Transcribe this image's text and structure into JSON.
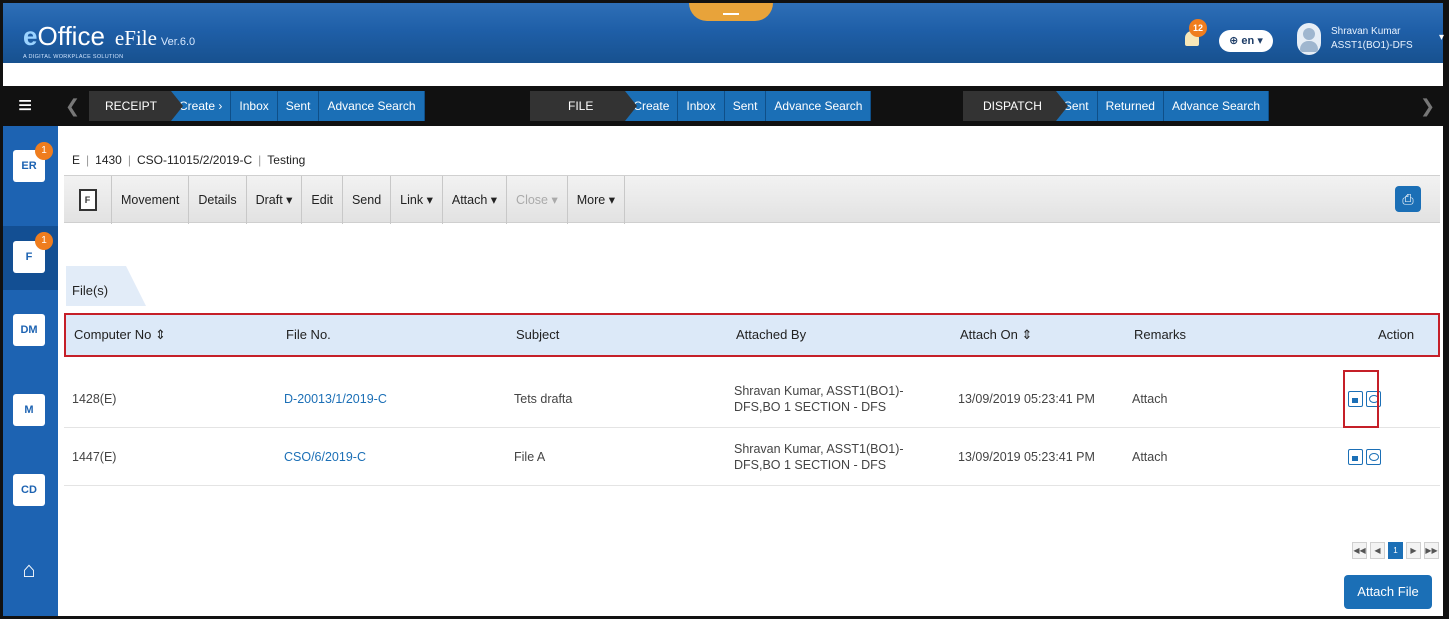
{
  "header": {
    "logo_e": "e",
    "logo_office": "Office",
    "logo_efile": "eFile",
    "logo_version": "Ver.6.0",
    "logo_tagline": "A DIGITAL WORKPLACE SOLUTION",
    "notification_count": "12",
    "language": "en",
    "user_name": "Shravan Kumar",
    "user_role": "ASST1(BO1)-DFS"
  },
  "menubar": {
    "receipt": {
      "title": "RECEIPT",
      "items": [
        "Create",
        "Inbox",
        "Sent",
        "Advance Search"
      ]
    },
    "file": {
      "title": "FILE",
      "items": [
        "Create",
        "Inbox",
        "Sent",
        "Advance Search"
      ]
    },
    "dispatch": {
      "title": "DISPATCH",
      "items": [
        "Sent",
        "Returned",
        "Advance Search"
      ]
    }
  },
  "sidebar": {
    "items": [
      {
        "label": "ER",
        "badge": "1",
        "icon": "receipt-icon"
      },
      {
        "label": "F",
        "badge": "1",
        "icon": "file-icon"
      },
      {
        "label": "DM",
        "badge": "",
        "icon": "dispatch-icon"
      },
      {
        "label": "M",
        "badge": "",
        "icon": "management-icon"
      },
      {
        "label": "CD",
        "badge": "",
        "icon": "settings-icon"
      },
      {
        "label": "",
        "badge": "",
        "icon": "emblem-icon"
      }
    ]
  },
  "breadcrumb": {
    "type": "E",
    "number": "1430",
    "file_no": "CSO-11015/2/2019-C",
    "subject": "Testing"
  },
  "toolbar": {
    "items": [
      "Movement",
      "Details",
      "Draft",
      "Edit",
      "Send",
      "Link",
      "Attach",
      "Close",
      "More"
    ],
    "file_icon_label": "F"
  },
  "files": {
    "section_title": "File(s)",
    "columns": [
      "Computer No",
      "File No.",
      "Subject",
      "Attached By",
      "Attach On",
      "Remarks",
      "Action"
    ],
    "rows": [
      {
        "computer_no": "1428(E)",
        "file_no": "D-20013/1/2019-C",
        "subject": "Tets drafta",
        "attached_by_1": "Shravan Kumar, ASST1(BO1)-",
        "attached_by_2": "DFS,BO 1 SECTION - DFS",
        "attach_on": "13/09/2019 05:23:41 PM",
        "remarks": "Attach"
      },
      {
        "computer_no": "1447(E)",
        "file_no": "CSO/6/2019-C",
        "subject": "File A",
        "attached_by_1": "Shravan Kumar, ASST1(BO1)-",
        "attached_by_2": "DFS,BO 1 SECTION - DFS",
        "attach_on": "13/09/2019 05:23:41 PM",
        "remarks": "Attach"
      }
    ],
    "pager_current": "1",
    "attach_button": "Attach File"
  }
}
